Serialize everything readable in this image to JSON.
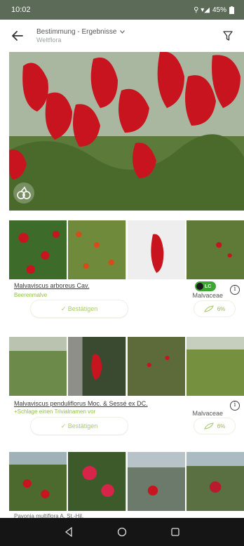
{
  "status": {
    "time": "10:02",
    "signal": "⚲ ▾◢",
    "battery": "45%"
  },
  "header": {
    "title": "Bestimmung - Ergebnisse",
    "subtitle": "Weltflora"
  },
  "results": [
    {
      "scientific_name": "Malvaviscus arboreus Cav.",
      "common_name": "Beerenmalve",
      "family": "Malvaceae",
      "status_badge": "LC",
      "confirm_label": "✓ Bestätigen",
      "score": "6%"
    },
    {
      "scientific_name": "Malvaviscus penduliflorus Moc. & Sessé ex DC.",
      "common_name": "+Schlage einen Trivialnamen vor",
      "family": "Malvaceae",
      "confirm_label": "✓ Bestätigen",
      "score": "6%"
    },
    {
      "scientific_name": "Pavonia multiflora A. St.-Hil."
    }
  ],
  "colors": {
    "accent_green": "#8fbf3e",
    "lc_green": "#3fa535",
    "statusbar": "#5b6b57"
  }
}
